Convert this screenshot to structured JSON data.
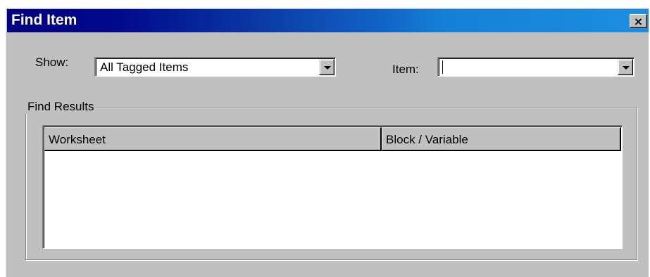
{
  "window": {
    "title": "Find Item",
    "close_glyph": "×"
  },
  "show": {
    "label": "Show:",
    "value": "All Tagged Items"
  },
  "item": {
    "label": "Item:",
    "value": ""
  },
  "results": {
    "group_label": "Find Results",
    "columns": [
      "Worksheet",
      "Block / Variable"
    ],
    "rows": []
  },
  "icons": {
    "close": "close-icon",
    "dropdown": "chevron-down-icon"
  },
  "colors": {
    "titlebar_start": "#00007f",
    "titlebar_end": "#1c8ee0",
    "face": "#c0c0c0"
  }
}
